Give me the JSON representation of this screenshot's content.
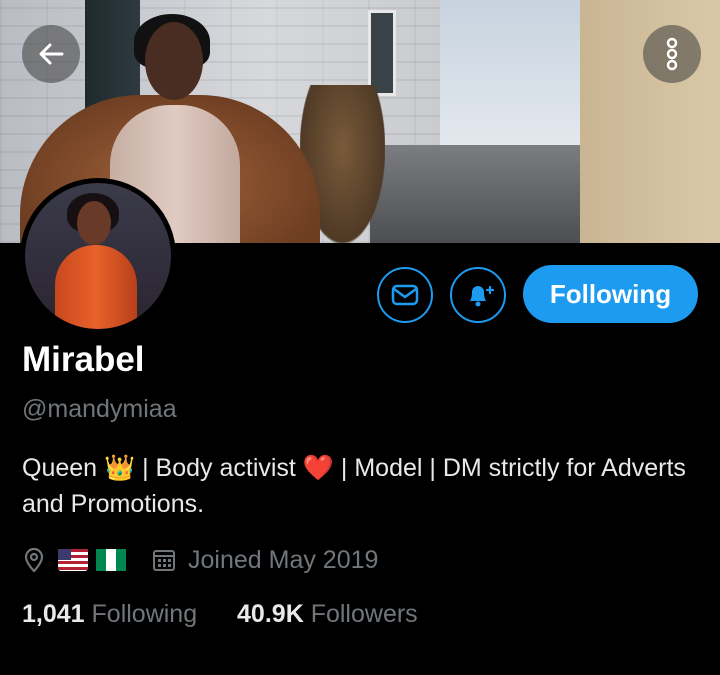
{
  "profile": {
    "name": "Mirabel",
    "handle": "@mandymiaa",
    "bio": {
      "part1": "Queen ",
      "crown_emoji": "👑",
      "part2": " | Body activist ",
      "heart_emoji": "❤️",
      "part3": " | Model | DM strictly for Adverts and Promotions."
    },
    "joined": "Joined May 2019",
    "following_count": "1,041",
    "following_label": "Following",
    "followers_count": "40.9K",
    "followers_label": "Followers"
  },
  "actions": {
    "follow_state_label": "Following"
  },
  "colors": {
    "accent": "#1d9bf0",
    "secondary_text": "#71767b",
    "background": "#000000"
  },
  "icons": [
    "back-arrow-icon",
    "more-options-icon",
    "envelope-icon",
    "bell-plus-icon",
    "location-pin-icon",
    "calendar-icon",
    "us-flag-icon",
    "nigeria-flag-icon"
  ]
}
